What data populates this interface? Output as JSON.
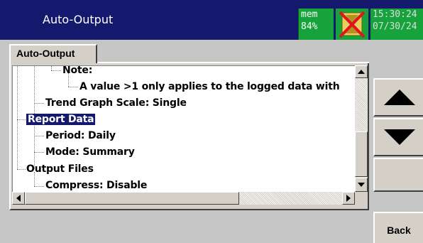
{
  "header": {
    "title": "Auto-Output",
    "mem_label": "mem",
    "mem_value": "84%",
    "time": "15:30:24",
    "date": "07/30/24",
    "alarm_icon": "hourglass-disabled-icon"
  },
  "tab": {
    "label": "Auto-Output"
  },
  "tree": {
    "items": [
      {
        "label": "Note:",
        "selected": false
      },
      {
        "label": "A value >1 only applies to the logged data with",
        "selected": false
      },
      {
        "label": "Trend Graph Scale: Single",
        "selected": false
      },
      {
        "label": "Report Data",
        "selected": true
      },
      {
        "label": "Period: Daily",
        "selected": false
      },
      {
        "label": "Mode: Summary",
        "selected": false
      },
      {
        "label": "Output Files",
        "selected": false
      },
      {
        "label": "Compress: Disable",
        "selected": false
      }
    ]
  },
  "side_buttons": {
    "up_icon": "triangle-up-icon",
    "down_icon": "triangle-down-icon",
    "back_label": "Back"
  },
  "colors": {
    "title_bar": "#14196e",
    "status_green": "#17a33c",
    "selection": "#14196e",
    "background": "#c6c6c6"
  }
}
